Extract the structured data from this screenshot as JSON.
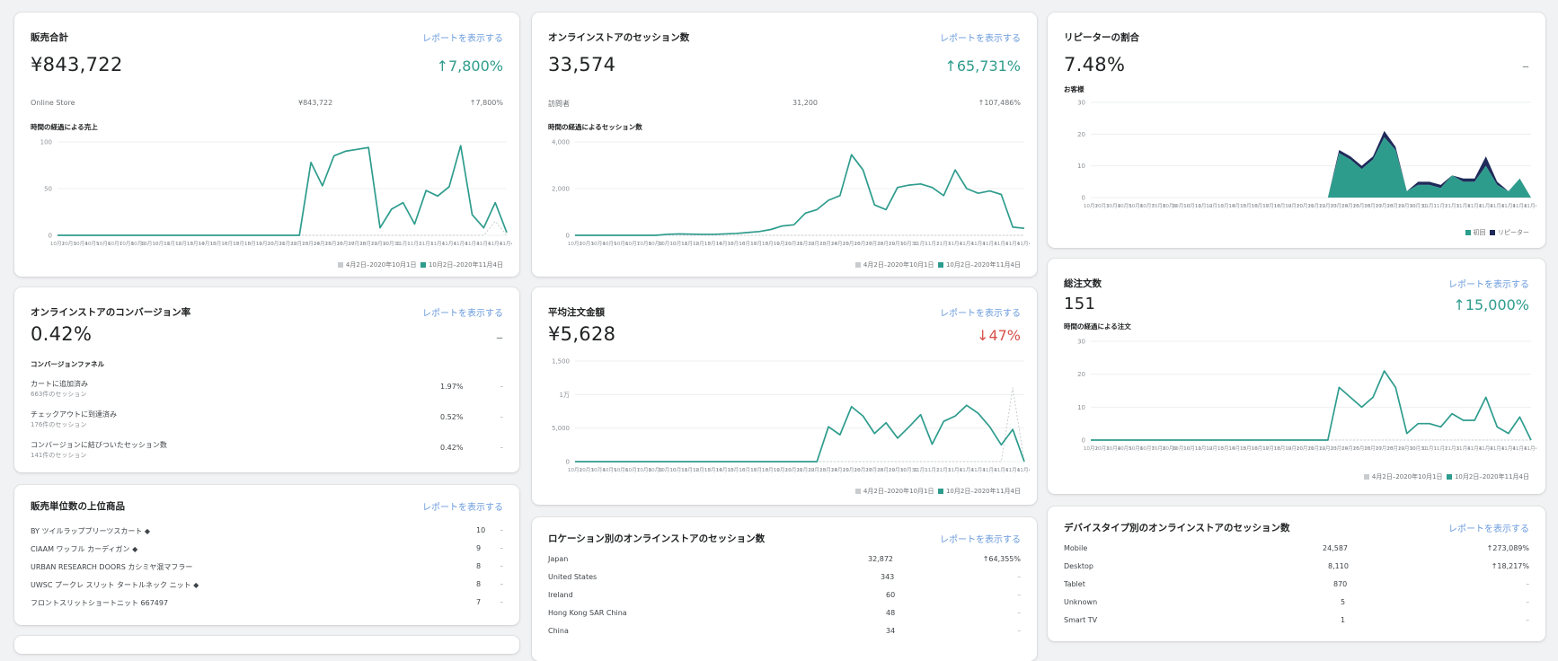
{
  "cards": {
    "sales_total": {
      "title": "販売合計",
      "link": "レポートを表示する",
      "value": "¥843,722",
      "delta": "↑7,800%",
      "channel": {
        "name": "Online Store",
        "value": "¥843,722",
        "delta": "↑7,800%"
      },
      "chart_label": "時間の経過による売上",
      "y_ticks": [
        "100",
        "50",
        "0"
      ],
      "legend": [
        "4月2日–2020年10月1日",
        "10月2日–2020年11月4日"
      ]
    },
    "sessions": {
      "title": "オンラインストアのセッション数",
      "link": "レポートを表示する",
      "value": "33,574",
      "delta": "↑65,731%",
      "visitors": {
        "name": "訪問者",
        "value": "31,200",
        "delta": "↑107,486%"
      },
      "chart_label": "時間の経過によるセッション数",
      "y_ticks": [
        "4,000",
        "2,000",
        "0"
      ],
      "legend": [
        "4月2日–2020年10月1日",
        "10月2日–2020年11月4日"
      ]
    },
    "repeat_rate": {
      "title": "リピーターの割合",
      "value": "7.48%",
      "delta": "–",
      "chart_label": "お客様",
      "y_ticks": [
        "30",
        "20",
        "10",
        "0"
      ],
      "legend": [
        "初回",
        "リピーター"
      ]
    },
    "conversion": {
      "title": "オンラインストアのコンバージョン率",
      "link": "レポートを表示する",
      "value": "0.42%",
      "delta": "–",
      "funnel_label": "コンバージョンファネル",
      "rows": [
        {
          "label": "カートに追加済み",
          "sub": "663件のセッション",
          "value": "1.97%",
          "delta": "–"
        },
        {
          "label": "チェックアウトに到達済み",
          "sub": "176件のセッション",
          "value": "0.52%",
          "delta": "–"
        },
        {
          "label": "コンバージョンに結びついたセッション数",
          "sub": "141件のセッション",
          "value": "0.42%",
          "delta": "–"
        }
      ]
    },
    "aov": {
      "title": "平均注文金額",
      "link": "レポートを表示する",
      "value": "¥5,628",
      "delta": "↓47%",
      "y_ticks": [
        "1,500",
        "1万",
        "5,000",
        "0"
      ],
      "legend": [
        "4月2日–2020年10月1日",
        "10月2日–2020年11月4日"
      ]
    },
    "orders": {
      "title": "総注文数",
      "link": "レポートを表示する",
      "value": "151",
      "delta": "↑15,000%",
      "chart_label": "時間の経過による注文",
      "y_ticks": [
        "30",
        "20",
        "10",
        "0"
      ],
      "legend": [
        "4月2日–2020年10月1日",
        "10月2日–2020年11月4日"
      ]
    },
    "top_products": {
      "title": "販売単位数の上位商品",
      "link": "レポートを表示する",
      "rows": [
        {
          "name": "BY ツイルラッププリーツスカート ◆",
          "value": "10",
          "delta": "–"
        },
        {
          "name": "CIAAM ワッフル カーディガン ◆",
          "value": "9",
          "delta": "–"
        },
        {
          "name": "URBAN RESEARCH DOORS カシミヤ混マフラー",
          "value": "8",
          "delta": "–"
        },
        {
          "name": "UWSC プークレ スリット タートルネック ニット ◆",
          "value": "8",
          "delta": "–"
        },
        {
          "name": "フロントスリットショートニット 667497",
          "value": "7",
          "delta": "–"
        }
      ]
    },
    "location_sessions": {
      "title": "ロケーション別のオンラインストアのセッション数",
      "link": "レポートを表示する",
      "rows": [
        {
          "name": "Japan",
          "value": "32,872",
          "delta": "↑64,355%"
        },
        {
          "name": "United States",
          "value": "343",
          "delta": "–"
        },
        {
          "name": "Ireland",
          "value": "60",
          "delta": "–"
        },
        {
          "name": "Hong Kong SAR China",
          "value": "48",
          "delta": "–"
        },
        {
          "name": "China",
          "value": "34",
          "delta": "–"
        }
      ]
    },
    "device_sessions": {
      "title": "デバイスタイプ別のオンラインストアのセッション数",
      "link": "レポートを表示する",
      "rows": [
        {
          "name": "Mobile",
          "value": "24,587",
          "delta": "↑273,089%"
        },
        {
          "name": "Desktop",
          "value": "8,110",
          "delta": "↑18,217%"
        },
        {
          "name": "Tablet",
          "value": "870",
          "delta": "–"
        },
        {
          "name": "Unknown",
          "value": "5",
          "delta": "–"
        },
        {
          "name": "Smart TV",
          "value": "1",
          "delta": "–"
        }
      ]
    }
  },
  "chart_data": [
    {
      "type": "line",
      "title": "時間の経過による売上",
      "ylim": [
        0,
        100
      ],
      "x_count": 40,
      "series": [
        {
          "name": "4月2日–2020年10月1日",
          "color": "#c9cccf",
          "values": [
            0,
            0,
            0,
            0,
            0,
            0,
            0,
            0,
            0,
            0,
            0,
            0,
            0,
            0,
            0,
            0,
            0,
            0,
            0,
            0,
            0,
            0,
            0,
            0,
            0,
            0,
            0,
            0,
            0,
            0,
            0,
            0,
            0,
            0,
            0,
            0,
            0,
            0,
            15,
            0
          ]
        },
        {
          "name": "10月2日–2020年11月4日",
          "color": "#2e9c8d",
          "values": [
            0,
            0,
            0,
            0,
            0,
            0,
            0,
            0,
            0,
            0,
            0,
            0,
            0,
            0,
            0,
            0,
            0,
            0,
            0,
            0,
            0,
            0,
            78,
            53,
            85,
            90,
            92,
            94,
            8,
            28,
            35,
            12,
            48,
            42,
            52,
            96,
            22,
            8,
            35,
            3
          ]
        }
      ]
    },
    {
      "type": "line",
      "title": "時間の経過によるセッション数",
      "ylim": [
        0,
        4000
      ],
      "x_count": 40,
      "series": [
        {
          "name": "4月2日–2020年10月1日",
          "color": "#c9cccf",
          "values": [
            0,
            0,
            0,
            0,
            0,
            0,
            0,
            0,
            0,
            0,
            0,
            0,
            0,
            0,
            0,
            0,
            0,
            0,
            0,
            0,
            0,
            0,
            0,
            0,
            0,
            0,
            0,
            0,
            0,
            0,
            0,
            0,
            0,
            0,
            0,
            0,
            0,
            0,
            0,
            0
          ]
        },
        {
          "name": "10月2日–2020年11月4日",
          "color": "#2e9c8d",
          "values": [
            0,
            0,
            0,
            0,
            0,
            0,
            0,
            0,
            40,
            60,
            50,
            40,
            40,
            60,
            80,
            120,
            160,
            250,
            400,
            450,
            950,
            1100,
            1500,
            1700,
            3450,
            2800,
            1300,
            1100,
            2050,
            2150,
            2200,
            2050,
            1700,
            2800,
            2000,
            1800,
            1900,
            1750,
            350,
            300
          ]
        }
      ]
    },
    {
      "type": "area",
      "title": "お客様",
      "ylim": [
        0,
        30
      ],
      "x_count": 40,
      "series": [
        {
          "name": "初回",
          "color": "#2e9c8d",
          "values": [
            0,
            0,
            0,
            0,
            0,
            0,
            0,
            0,
            0,
            0,
            0,
            0,
            0,
            0,
            0,
            0,
            0,
            0,
            0,
            0,
            0,
            0,
            14,
            12,
            9,
            12,
            19,
            15,
            2,
            4,
            4,
            3,
            7,
            5,
            5,
            10,
            4,
            2,
            6,
            0
          ]
        },
        {
          "name": "リピーター",
          "color": "#1f2a5a",
          "values": [
            0,
            0,
            0,
            0,
            0,
            0,
            0,
            0,
            0,
            0,
            0,
            0,
            0,
            0,
            0,
            0,
            0,
            0,
            0,
            0,
            0,
            0,
            1,
            1,
            1,
            1,
            2,
            1,
            0,
            1,
            1,
            1,
            0,
            1,
            1,
            3,
            1,
            0,
            0,
            0
          ]
        }
      ]
    },
    {
      "type": "line",
      "title": "平均注文金額",
      "ylim": [
        0,
        15000
      ],
      "x_count": 40,
      "series": [
        {
          "name": "4月2日–2020年10月1日",
          "color": "#c9cccf",
          "values": [
            0,
            0,
            0,
            0,
            0,
            0,
            0,
            0,
            0,
            0,
            0,
            0,
            0,
            0,
            0,
            0,
            0,
            0,
            0,
            0,
            0,
            0,
            0,
            0,
            0,
            0,
            0,
            0,
            0,
            0,
            0,
            0,
            0,
            0,
            0,
            0,
            0,
            0,
            11000,
            0
          ]
        },
        {
          "name": "10月2日–2020年11月4日",
          "color": "#2e9c8d",
          "values": [
            0,
            0,
            0,
            0,
            0,
            0,
            0,
            0,
            0,
            0,
            0,
            0,
            0,
            0,
            0,
            0,
            0,
            0,
            0,
            0,
            0,
            0,
            5200,
            4000,
            8200,
            6800,
            4200,
            5800,
            3500,
            5200,
            7000,
            2600,
            6000,
            6800,
            8400,
            7200,
            5200,
            2500,
            4800,
            0
          ]
        }
      ]
    },
    {
      "type": "line",
      "title": "時間の経過による注文",
      "ylim": [
        0,
        30
      ],
      "x_count": 40,
      "series": [
        {
          "name": "4月2日–2020年10月1日",
          "color": "#c9cccf",
          "values": [
            0,
            0,
            0,
            0,
            0,
            0,
            0,
            0,
            0,
            0,
            0,
            0,
            0,
            0,
            0,
            0,
            0,
            0,
            0,
            0,
            0,
            0,
            0,
            0,
            0,
            0,
            0,
            0,
            0,
            0,
            0,
            0,
            0,
            0,
            0,
            0,
            0,
            0,
            0,
            0
          ]
        },
        {
          "name": "10月2日–2020年11月4日",
          "color": "#2e9c8d",
          "values": [
            0,
            0,
            0,
            0,
            0,
            0,
            0,
            0,
            0,
            0,
            0,
            0,
            0,
            0,
            0,
            0,
            0,
            0,
            0,
            0,
            0,
            0,
            16,
            13,
            10,
            13,
            21,
            16,
            2,
            5,
            5,
            4,
            8,
            6,
            6,
            13,
            4,
            2,
            7,
            0
          ]
        }
      ]
    }
  ]
}
